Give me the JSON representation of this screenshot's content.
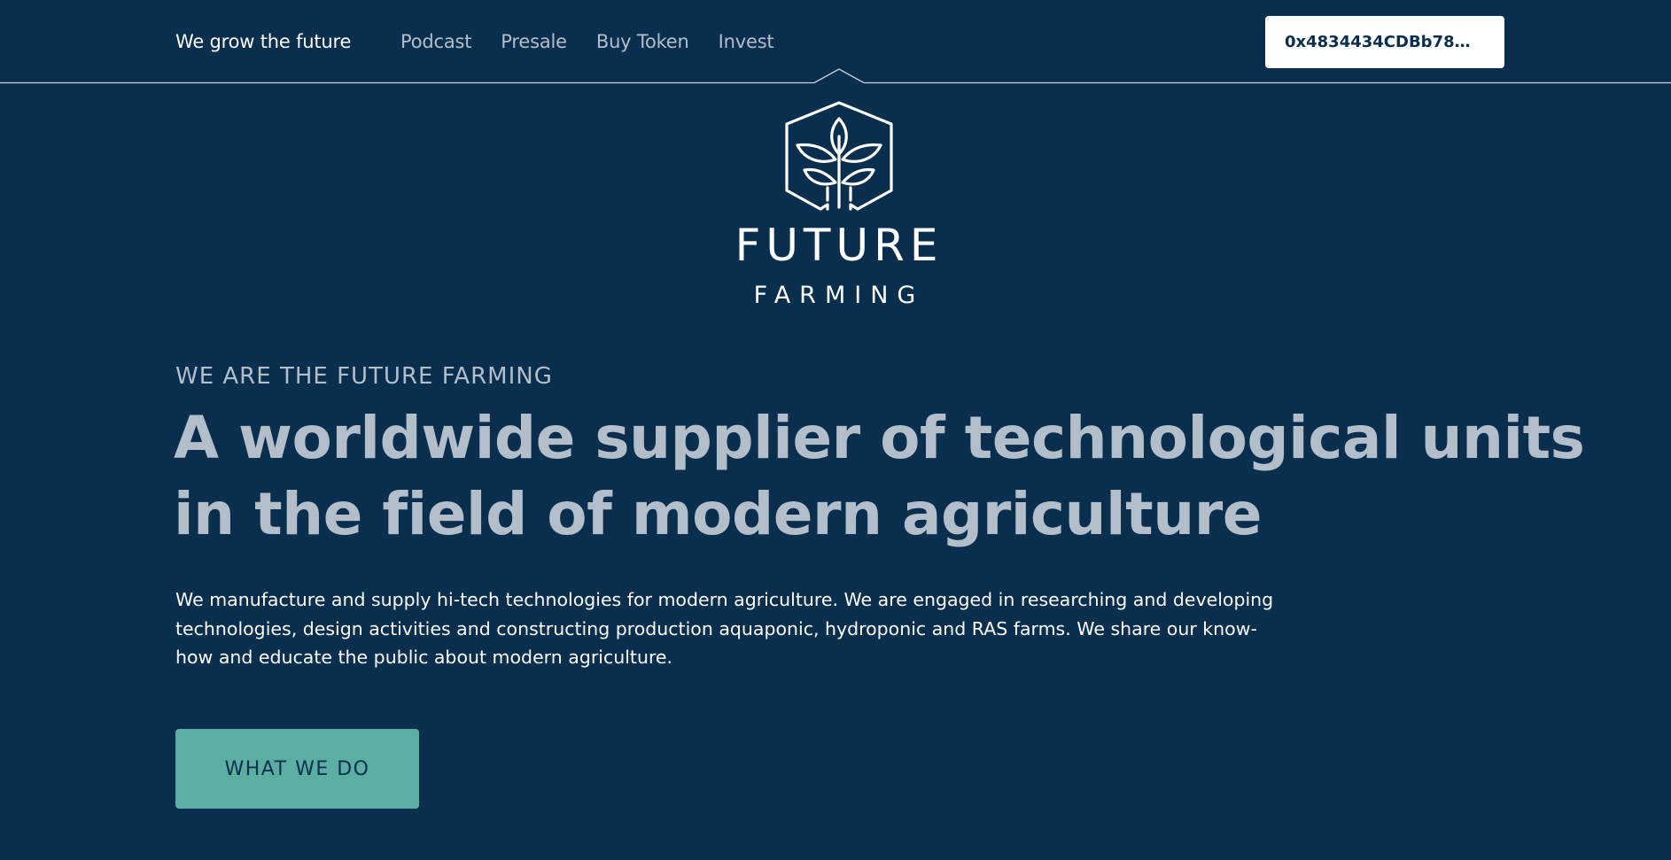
{
  "header": {
    "brand": "We grow the future",
    "nav": [
      {
        "label": "Podcast"
      },
      {
        "label": "Presale"
      },
      {
        "label": "Buy Token"
      },
      {
        "label": "Invest"
      }
    ],
    "wallet_label": "0x4834434CDBb78…"
  },
  "logo": {
    "wordmark": "FUTURE",
    "subword": "FARMING",
    "icon": "leaf-hexagon-icon"
  },
  "hero": {
    "eyebrow": "WE ARE THE FUTURE FARMING",
    "headline": "A worldwide supplier of technological units in the field of modern agriculture",
    "description": "We manufacture and supply hi-tech technologies for modern agriculture. We are engaged in researching and developing technologies, design activities and constructing production aquaponic, hydroponic and RAS farms. We share our know-how and educate the public about modern agriculture.",
    "cta_label": "WHAT WE DO"
  },
  "colors": {
    "background": "#0a2e4d",
    "muted_text": "#b2bfcb",
    "accent": "#5aafa2",
    "white": "#ffffff"
  }
}
